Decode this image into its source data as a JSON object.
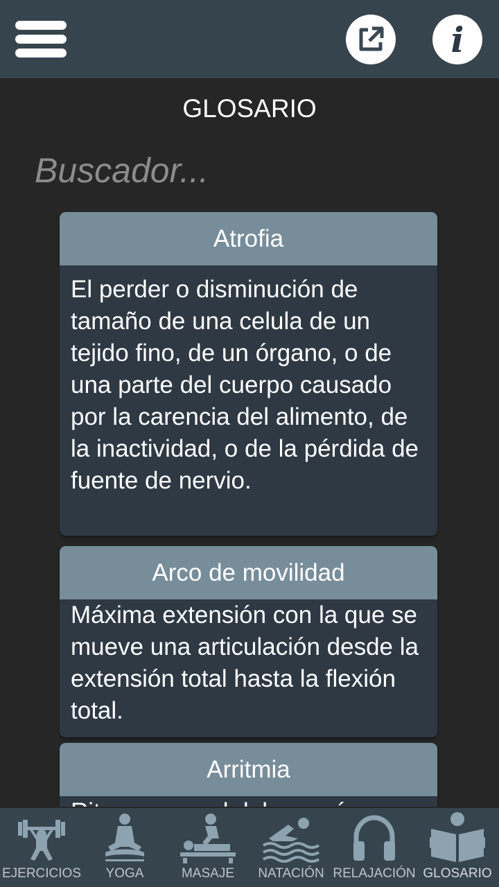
{
  "topbar": {
    "menu_icon": "hamburger-menu-icon",
    "share_icon": "external-link-icon",
    "info_icon": "info-icon",
    "info_glyph": "i"
  },
  "page": {
    "title": "GLOSARIO"
  },
  "search": {
    "placeholder": "Buscador...",
    "value": ""
  },
  "glossary": [
    {
      "term": "Atrofia",
      "definition": "El perder o disminución de tamaño de una celula de un tejido fino, de un órgano, o de una parte del cuerpo causado por la carencia del alimento, de la inactividad, o de la pérdida de fuente de nervio."
    },
    {
      "term": "Arco de movilidad",
      "definition": "Máxima extensión con la que se mueve una articulación desde la extensión total hasta la flexión total."
    },
    {
      "term": "Arritmia",
      "definition": "Ritmo anormal del corazón."
    }
  ],
  "nav": [
    {
      "label": "EJERCICIOS",
      "icon": "weightlifter-icon"
    },
    {
      "label": "YOGA",
      "icon": "meditation-icon"
    },
    {
      "label": "MASAJE",
      "icon": "massage-icon"
    },
    {
      "label": "NATACIÓN",
      "icon": "swimmer-icon"
    },
    {
      "label": "RELAJACIÓN",
      "icon": "headphones-icon"
    },
    {
      "label": "GLOSARIO",
      "icon": "book-reader-icon"
    }
  ],
  "colors": {
    "background": "#262626",
    "bar": "#36444e",
    "card_header": "#788d9a",
    "card_body": "#2e3944",
    "icon": "#8ea3b0"
  }
}
